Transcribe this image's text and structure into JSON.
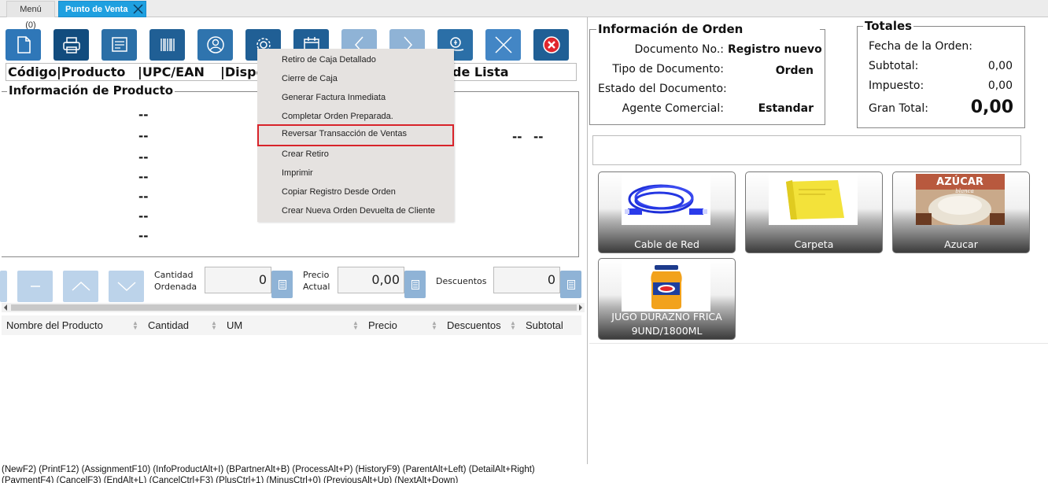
{
  "tabs": {
    "menu": "Menú (0)",
    "active": "Punto de Venta"
  },
  "toolbar": {
    "buttons": [
      {
        "icon": "new-document-icon",
        "color": "#1f6fb2"
      },
      {
        "icon": "printer-icon",
        "color": "#0f4d80"
      },
      {
        "icon": "invoice-icon",
        "color": "#2a6ea5"
      },
      {
        "icon": "barcode-icon",
        "color": "#1f5f96"
      },
      {
        "icon": "user-icon",
        "color": "#2a6ea5"
      },
      {
        "icon": "gear-icon",
        "color": "#1f5f96"
      },
      {
        "icon": "calendar-icon",
        "color": "#1f5f96"
      },
      {
        "icon": "previous-icon",
        "color": "#8fb3d6"
      },
      {
        "icon": "next-icon",
        "color": "#8fb3d6"
      },
      {
        "icon": "cash-icon",
        "color": "#2a6ea5"
      },
      {
        "icon": "cancel-x-icon",
        "color": "#3a82c4"
      },
      {
        "icon": "close-red-icon",
        "color": "#1f5f96"
      }
    ]
  },
  "product_header": {
    "codigo": "Código",
    "producto": "|Producto",
    "upc": "|UPC/EAN",
    "disp": "|Dispo",
    "lista": "de Lista"
  },
  "product_info": {
    "legend": "Información de Producto",
    "dashes": [
      "--",
      "--",
      "--",
      "--",
      "--",
      "--"
    ],
    "price_dashes": [
      "--",
      "--"
    ]
  },
  "context_menu": {
    "items": [
      {
        "label": " Retiro de Caja Detallado",
        "selected": false
      },
      {
        "label": "Cierre de Caja",
        "selected": false
      },
      {
        "label": "Generar Factura Inmediata",
        "selected": false
      },
      {
        "label": " Completar Orden Preparada.",
        "selected": false
      },
      {
        "label": "Reversar Transacción de Ventas",
        "selected": true
      },
      {
        "label": "Crear Retiro",
        "selected": false
      },
      {
        "label": "Imprimir",
        "selected": false
      },
      {
        "label": "Copiar Registro Desde Orden",
        "selected": false
      },
      {
        "label": "Crear Nueva Orden Devuelta de Cliente",
        "selected": false
      }
    ]
  },
  "line_edit": {
    "qty_label": "Cantidad\nOrdenada",
    "qty_value": "0",
    "price_label": "Precio\nActual",
    "price_value": "0,00",
    "discount_label": "Descuentos",
    "discount_value": "0"
  },
  "table": {
    "columns": [
      "Nombre del Producto",
      "Cantidad",
      "UM",
      "Precio",
      "Descuentos",
      "Subtotal"
    ]
  },
  "order_info": {
    "legend": "Información de Orden",
    "doc_no_label": "Documento No.:",
    "doc_no_value": "Registro nuevo",
    "doc_type_label": "Tipo de Documento:",
    "doc_type_value": "Orden",
    "doc_status_label": "Estado del Documento:",
    "doc_status_value": "",
    "agent_label": "Agente Comercial:",
    "agent_value": "Estandar"
  },
  "totals": {
    "legend": "Totales",
    "date_label": "Fecha de la Orden:",
    "date_value": "",
    "subtotal_label": "Subtotal:",
    "subtotal_value": "0,00",
    "tax_label": "Impuesto:",
    "tax_value": "0,00",
    "grand_label": "Gran Total:",
    "grand_value": "0,00"
  },
  "products": [
    {
      "name": "Cable de Red",
      "name2": ""
    },
    {
      "name": "Carpeta",
      "name2": ""
    },
    {
      "name": "Azucar",
      "name2": ""
    },
    {
      "name": "JUGO DURAZNO FRICA",
      "name2": "9UND/1800ML"
    }
  ],
  "product_images": {
    "azucar_brand": "AZÚCAR",
    "azucar_sub": "blanca"
  },
  "shortcuts": {
    "line1": "(NewF2) (PrintF12) (AssignmentF10) (InfoProductAlt+I) (BPartnerAlt+B) (ProcessAlt+P) (HistoryF9) (ParentAlt+Left) (DetailAlt+Right)",
    "line2": "(PaymentF4) (CancelF3) (EndAlt+L) (CancelCtrl+F3) (PlusCtrl+1) (MinusCtrl+0) (PreviousAlt+Up) (NextAlt+Down)"
  }
}
